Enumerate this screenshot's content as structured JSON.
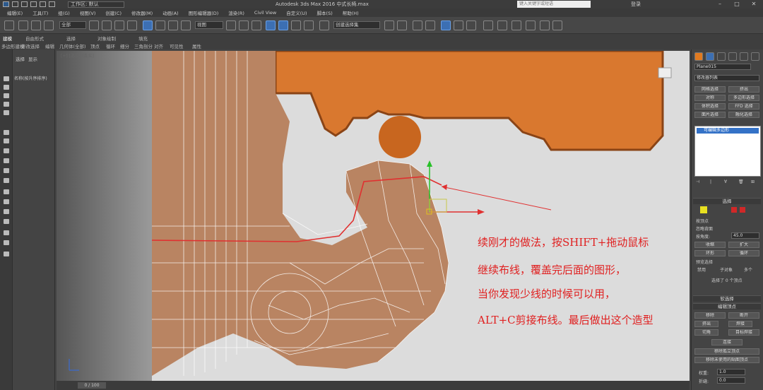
{
  "titlebar": {
    "workspace": "工作区: 默认",
    "title": "Autodesk 3ds Max 2016     中式长椅.max",
    "search_placeholder": "键入关键字或短语",
    "login": "登录",
    "minimize": "–",
    "maximize": "□",
    "close": "✕"
  },
  "menubar": {
    "items": [
      "编辑(E)",
      "工具(T)",
      "组(G)",
      "视图(V)",
      "创建(C)",
      "修改器(M)",
      "动画(A)",
      "图形编辑器(D)",
      "渲染(R)",
      "Civil View",
      "自定义(U)",
      "脚本(S)",
      "帮助(H)"
    ]
  },
  "toolbar": {
    "selection_filter": "全部",
    "ref_coord": "视图",
    "named_selection": "创建选择集"
  },
  "ribbon": {
    "tabs": [
      "建模",
      "自由形式",
      "选择",
      "对象绘制",
      "填充"
    ],
    "subtabs": [
      "多边形建模",
      "修改选择",
      "编辑",
      "几何体(全部)",
      "顶点",
      "循环",
      "细分",
      "三角剖分",
      "对齐",
      "可见性",
      "属性"
    ]
  },
  "explorer": {
    "tabs": [
      "选择",
      "显示"
    ],
    "list_header": "名称(按升序排序)"
  },
  "viewport": {
    "label": "[+] [透视] [真实]",
    "annotation": [
      "续刚才的做法，按SHIFT+拖动鼠标",
      "继续布线，覆盖完后面的图形，",
      "当你发现少线的时候可以用，",
      "ALT+C剪接布线。最后做出这个造型"
    ],
    "colors": {
      "wood": "#b98462",
      "orange_wood": "#d9782f",
      "wire": "#ffffff",
      "edge_highlight": "#e03030"
    }
  },
  "timeline": {
    "frame": "0 / 100"
  },
  "command_panel": {
    "object_name": "Plane015",
    "modifier_list": "修改器列表",
    "buttons": [
      [
        "网格选择",
        "挤出"
      ],
      [
        "对称",
        "多边形选择"
      ],
      [
        "体积选择",
        "FFD 选择"
      ],
      [
        "面片选择",
        "融化选择"
      ]
    ],
    "stack_item": "可编辑多边形",
    "selection_rollout": "选择",
    "checks": [
      "按顶点",
      "忽略背面",
      "按角度:"
    ],
    "angle_value": "45.0",
    "shrink": "收缩",
    "grow": "扩大",
    "ring": "环形",
    "loop": "循环",
    "preview_selection": "预览选择",
    "preview_options": [
      "禁用",
      "子对象",
      "多个"
    ],
    "selected_status": "选择了 0 个顶点",
    "soft_selection": "软选择",
    "edit_vertices": "编辑顶点",
    "remove": "移除",
    "break": "断开",
    "extrude": "挤出",
    "weld": "焊接",
    "chamfer": "切角",
    "target_weld": "目标焊接",
    "connect": "连接",
    "remove_isolated": "移除孤立顶点",
    "remove_unused_map": "移除未使用的贴图顶点",
    "weight_label": "权重:",
    "weight_value": "1.0",
    "crease_label": "折缝:",
    "crease_value": "0.0"
  }
}
